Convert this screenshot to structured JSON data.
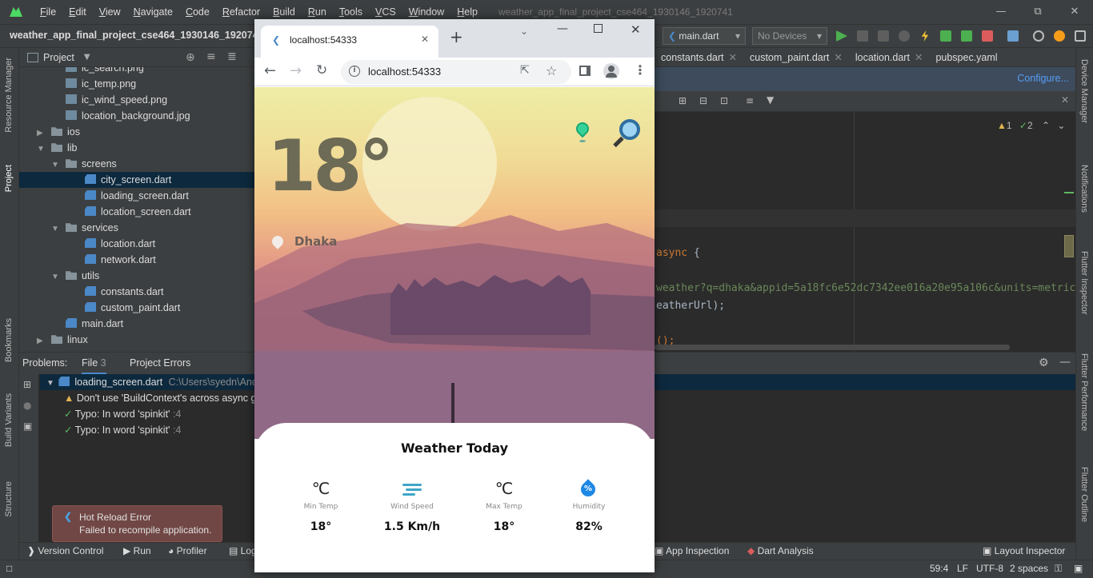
{
  "menu": {
    "items": [
      "File",
      "Edit",
      "View",
      "Navigate",
      "Code",
      "Refactor",
      "Build",
      "Run",
      "Tools",
      "VCS",
      "Window",
      "Help"
    ],
    "window_title": "weather_app_final_project_cse464_1930146_1920741"
  },
  "toolbar": {
    "project_name": "weather_app_final_project_cse464_1930146_1920741",
    "run_config": "main.dart",
    "device": "No Devices"
  },
  "left_stripe": {
    "resource_manager": "Resource Manager",
    "project": "Project",
    "bookmarks": "Bookmarks",
    "build_variants": "Build Variants",
    "structure": "Structure"
  },
  "right_stripe": {
    "device_manager": "Device Manager",
    "notifications": "Notifications",
    "flutter_inspector": "Flutter Inspector",
    "flutter_performance": "Flutter Performance",
    "flutter_outline": "Flutter Outline"
  },
  "project_panel": {
    "title": "Project",
    "tree": [
      {
        "label": "ic_search.png",
        "type": "img"
      },
      {
        "label": "ic_temp.png",
        "type": "img"
      },
      {
        "label": "ic_wind_speed.png",
        "type": "img"
      },
      {
        "label": "location_background.jpg",
        "type": "img"
      },
      {
        "label": "ios",
        "type": "folder"
      },
      {
        "label": "lib",
        "type": "folder"
      },
      {
        "label": "screens",
        "type": "folder"
      },
      {
        "label": "city_screen.dart",
        "type": "dart"
      },
      {
        "label": "loading_screen.dart",
        "type": "dart"
      },
      {
        "label": "location_screen.dart",
        "type": "dart"
      },
      {
        "label": "services",
        "type": "folder"
      },
      {
        "label": "location.dart",
        "type": "dart"
      },
      {
        "label": "network.dart",
        "type": "dart"
      },
      {
        "label": "utils",
        "type": "folder"
      },
      {
        "label": "constants.dart",
        "type": "dart"
      },
      {
        "label": "custom_paint.dart",
        "type": "dart"
      },
      {
        "label": "main.dart",
        "type": "dart"
      },
      {
        "label": "linux",
        "type": "folder"
      }
    ]
  },
  "editor": {
    "tabs": [
      "constants.dart",
      "custom_paint.dart",
      "location.dart",
      "pubspec.yaml"
    ],
    "configure": "Configure...",
    "inspection": {
      "warnings": "1",
      "typos": "2"
    },
    "code": {
      "async_kw": "async",
      "brace": "{",
      "url_line": "weather?q=dhaka&appid=5a18fc6e52dc7342ee016a20e95a106c&units=metric",
      "line2": "eatherUrl);",
      "line3": "();"
    }
  },
  "problems": {
    "title": "Problems:",
    "tab_file": "File",
    "file_count": "3",
    "tab_project": "Project Errors",
    "file_name": "loading_screen.dart",
    "file_path": "C:\\Users\\syedn\\AndroidS",
    "rows": [
      {
        "text": "Don't use 'BuildContext's across async gap",
        "loc": ""
      },
      {
        "text": "Typo: In word 'spinkit'",
        "loc": ":4"
      },
      {
        "text": "Typo: In word 'spinkit'",
        "loc": ":4"
      }
    ]
  },
  "toast": {
    "title": "Hot Reload Error",
    "message": "Failed to recompile application."
  },
  "bottom_tools": {
    "version_control": "Version Control",
    "run": "Run",
    "profiler": "Profiler",
    "logcat": "Log",
    "app_inspection": "App Inspection",
    "dart_analysis": "Dart Analysis",
    "layout_inspector": "Layout Inspector"
  },
  "status": {
    "position": "59:4",
    "line_sep": "LF",
    "encoding": "UTF-8",
    "indent": "2 spaces"
  },
  "browser": {
    "tab_title": "localhost:54333",
    "url": "localhost:54333"
  },
  "weather_app": {
    "temperature": "18°",
    "city": "Dhaka",
    "card_title": "Weather Today",
    "stats": [
      {
        "icon": "thermometer-icon",
        "glyph": "℃",
        "label": "Min Temp",
        "value": "18°"
      },
      {
        "icon": "wind-icon",
        "glyph": "",
        "label": "Wind Speed",
        "value": "1.5 Km/h"
      },
      {
        "icon": "thermometer-icon",
        "glyph": "℃",
        "label": "Max Temp",
        "value": "18°"
      },
      {
        "icon": "humidity-icon",
        "glyph": "%",
        "label": "Humidity",
        "value": "82%"
      }
    ]
  },
  "colors": {
    "ide_bg": "#2b2b2b",
    "panel_bg": "#3c3f41",
    "selection": "#0d293e",
    "toast_bg": "#704745",
    "accent_blue": "#589df6"
  }
}
